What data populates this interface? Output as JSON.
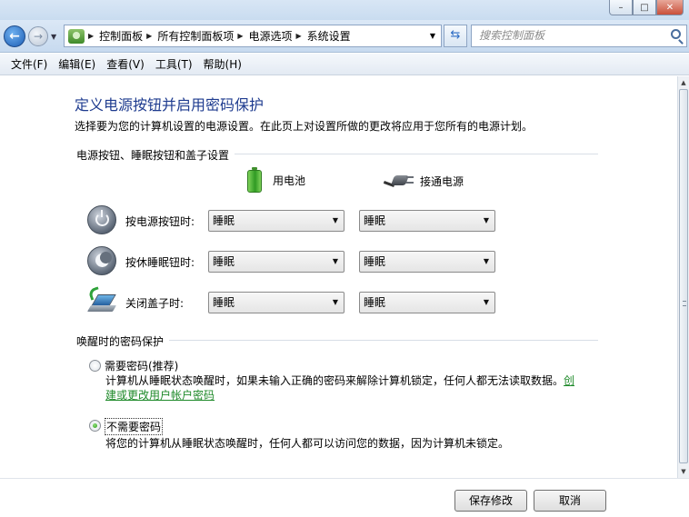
{
  "window": {
    "minimize": "–",
    "maximize": "□",
    "close": "✕"
  },
  "breadcrumb": [
    "控制面板",
    "所有控制面板项",
    "电源选项",
    "系统设置"
  ],
  "search": {
    "placeholder": "搜索控制面板"
  },
  "menu": [
    "文件(F)",
    "编辑(E)",
    "查看(V)",
    "工具(T)",
    "帮助(H)"
  ],
  "page": {
    "title": "定义电源按钮并启用密码保护",
    "description": "选择要为您的计算机设置的电源设置。在此页上对设置所做的更改将应用于您所有的电源计划。"
  },
  "buttons_section": {
    "heading": "电源按钮、睡眠按钮和盖子设置",
    "col_battery": "用电池",
    "col_plugged": "接通电源",
    "rows": [
      {
        "label": "按电源按钮时:",
        "battery": "睡眠",
        "plugged": "睡眠",
        "icon": "power-button-icon"
      },
      {
        "label": "按休睡眠钮时:",
        "battery": "睡眠",
        "plugged": "睡眠",
        "icon": "sleep-button-icon"
      },
      {
        "label": "关闭盖子时:",
        "battery": "睡眠",
        "plugged": "睡眠",
        "icon": "laptop-lid-icon"
      }
    ]
  },
  "password_section": {
    "heading": "唤醒时的密码保护",
    "option_require": {
      "label": "需要密码(推荐)",
      "desc": "计算机从睡眠状态唤醒时，如果未输入正确的密码来解除计算机锁定，任何人都无法读取数据。",
      "link": "创建或更改用户帐户密码",
      "checked": false
    },
    "option_none": {
      "label": "不需要密码",
      "desc": "将您的计算机从睡眠状态唤醒时，任何人都可以访问您的数据，因为计算机未锁定。",
      "checked": true
    }
  },
  "footer": {
    "save": "保存修改",
    "cancel": "取消"
  },
  "colors": {
    "title_blue": "#1e3b8f",
    "link_green": "#1f8a2a"
  }
}
